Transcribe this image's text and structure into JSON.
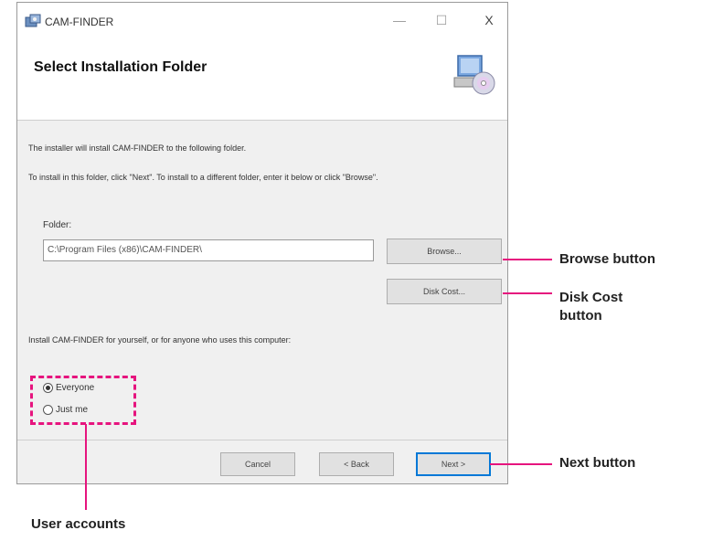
{
  "window": {
    "title": "CAM-FINDER",
    "minimize": "—",
    "maximize": "☐",
    "close": "X"
  },
  "header": {
    "title": "Select Installation Folder"
  },
  "body": {
    "intro": "The installer will install CAM-FINDER to the following folder.",
    "instructions": "To install in this folder, click \"Next\". To install to a different folder, enter it below or click \"Browse\".",
    "folder_label": "Folder:",
    "folder_value": "C:\\Program Files (x86)\\CAM-FINDER\\",
    "browse_label": "Browse...",
    "disk_cost_label": "Disk Cost...",
    "install_for": "Install CAM-FINDER for yourself, or for anyone who uses this computer:",
    "radio_everyone": "Everyone",
    "radio_just_me": "Just me",
    "everyone_selected": true
  },
  "footer": {
    "cancel_label": "Cancel",
    "back_label": "< Back",
    "next_label": "Next >"
  },
  "annotations": {
    "browse": "Browse button",
    "disk_cost_line1": "Disk Cost",
    "disk_cost_line2": "button",
    "next": "Next button",
    "user_accounts": "User accounts",
    "color": "#e6147e"
  },
  "icons": {
    "app": "installer-app-icon",
    "header": "computer-disc-icon"
  }
}
